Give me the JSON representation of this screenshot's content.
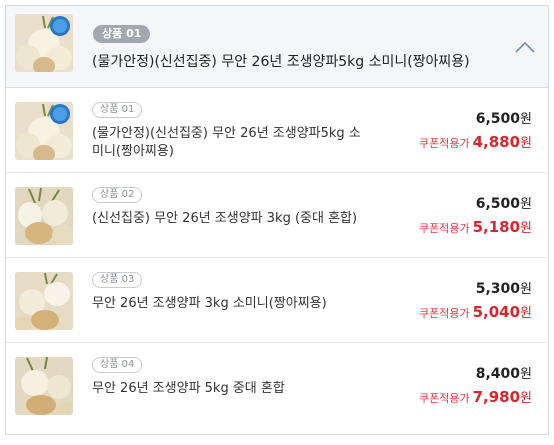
{
  "header": {
    "badge": "상품 01",
    "title": "(물가안정)(신선집중) 무안 26년 조생양파5kg 소미니(짱아찌용)",
    "collapse_icon": "chevron-up-icon"
  },
  "items": [
    {
      "badge": "상품 01",
      "name": "(물가안정)(신선집중) 무안 26년 조생양파5kg 소미니(짱아찌용)",
      "price": "6,500",
      "price_unit": "원",
      "coupon_label": "쿠폰적용가",
      "coupon_price": "4,880",
      "coupon_unit": "원",
      "has_sticker": true
    },
    {
      "badge": "상품 02",
      "name": "(신선집중) 무안 26년 조생양파 3kg (중대 혼합)",
      "price": "6,500",
      "price_unit": "원",
      "coupon_label": "쿠폰적용가",
      "coupon_price": "5,180",
      "coupon_unit": "원",
      "has_sticker": false
    },
    {
      "badge": "상품 03",
      "name": "무안 26년 조생양파 3kg 소미니(짱아찌용)",
      "price": "5,300",
      "price_unit": "원",
      "coupon_label": "쿠폰적용가",
      "coupon_price": "5,040",
      "coupon_unit": "원",
      "has_sticker": false
    },
    {
      "badge": "상품 04",
      "name": "무안 26년 조생양파 5kg 중대 혼합",
      "price": "8,400",
      "price_unit": "원",
      "coupon_label": "쿠폰적용가",
      "coupon_price": "7,980",
      "coupon_unit": "원",
      "has_sticker": false
    }
  ],
  "colors": {
    "header_bg": "#f4f6f9",
    "coupon_red": "#d9252d",
    "badge_gray": "#a3a8b0",
    "sticker_blue": "#2a78c8"
  }
}
